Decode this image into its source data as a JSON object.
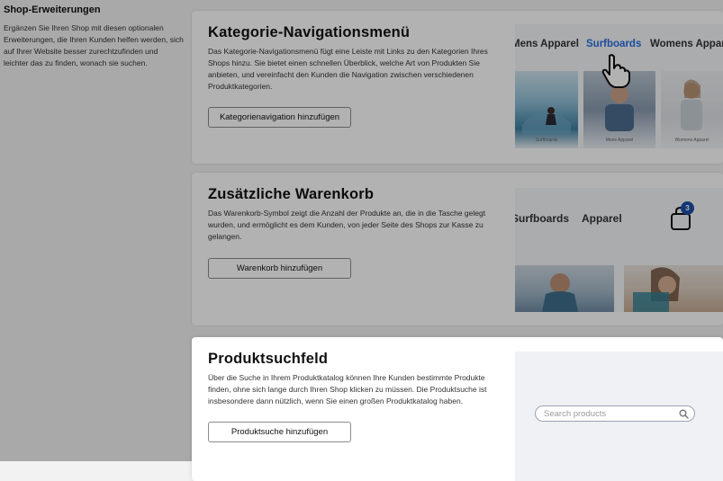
{
  "sidebar": {
    "title": "Shop-Erweiterungen",
    "description": "Ergänzen Sie Ihren Shop mit diesen optionalen Erweiterungen, die Ihren Kunden helfen werden, sich auf Ihrer Website besser zurechtzufinden und leichter das zu finden, wonach sie suchen."
  },
  "cards": [
    {
      "title": "Kategorie-Navigationsmenü",
      "description": "Das Kategorie-Navigationsmenü fügt eine Leiste mit Links zu den Kategorien Ihres Shops hinzu. Sie bietet einen schnellen Überblick, welche Art von Produkten Sie anbieten, und vereinfacht den Kunden die Navigation zwischen verschiedenen Produktkategorien.",
      "button_label": "Kategorienavigation hinzufügen",
      "preview": {
        "nav_items": [
          "Mens Apparel",
          "Surfboards",
          "Womens Apparel"
        ],
        "active_item": "Surfboards",
        "active_color": "#2a6de0",
        "thumb_captions": [
          "Surfboards",
          "Mens Apparel",
          "Womens Apparel"
        ],
        "cursor_icon": "hand-pointer-icon"
      }
    },
    {
      "title": "Zusätzliche Warenkorb",
      "description": "Das Warenkorb-Symbol zeigt die Anzahl der Produkte an, die in die Tasche gelegt wurden, und ermöglicht es dem Kunden, von jeder Seite des Shops zur Kasse zu gelangen.",
      "button_label": "Warenkorb hinzufügen",
      "preview": {
        "nav_items": [
          "Surfboards",
          "Apparel"
        ],
        "cart_count": "3",
        "cart_icon": "shopping-bag-icon",
        "badge_color": "#1c4fa8"
      }
    },
    {
      "title": "Produktsuchfeld",
      "description": "Über die Suche in Ihrem Produktkatalog können Ihre Kunden bestimmte Produkte finden, ohne sich lange durch Ihren Shop klicken zu müssen. Die Produktsuche ist insbesondere dann nützlich, wenn Sie einen großen Produktkatalog haben.",
      "button_label": "Produktsuche hinzufügen",
      "preview": {
        "search_placeholder": "Search products",
        "search_icon": "magnifier-icon"
      }
    }
  ]
}
